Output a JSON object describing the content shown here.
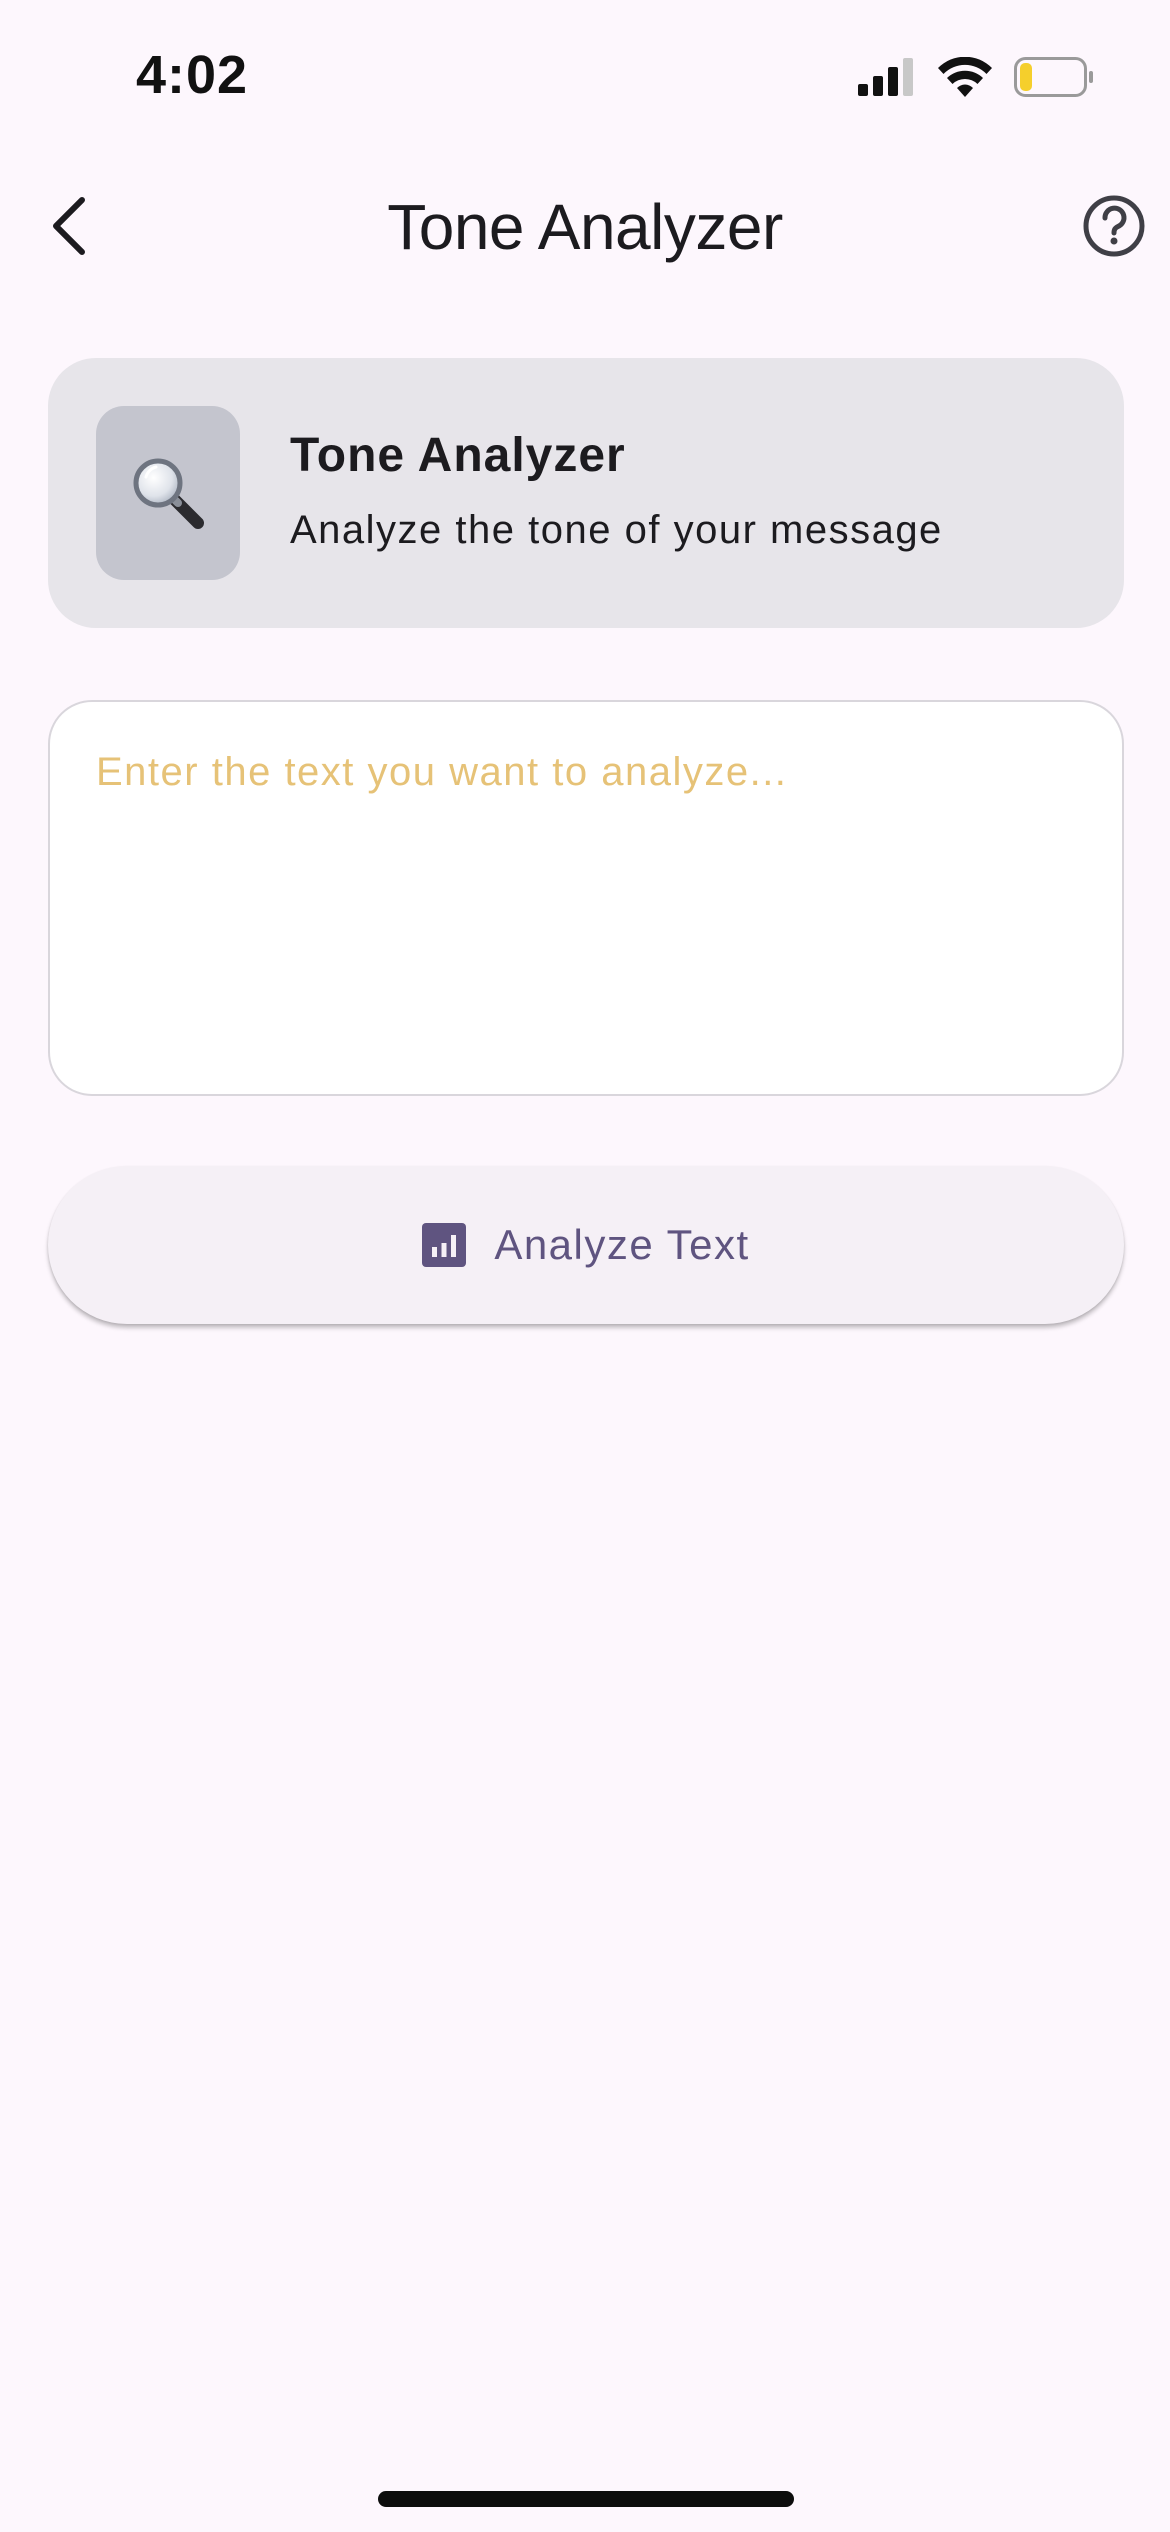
{
  "status_bar": {
    "time": "4:02",
    "icons": [
      "cellular-signal-icon",
      "wifi-icon",
      "battery-low-icon"
    ],
    "battery_color": "#f5cf2c"
  },
  "header": {
    "title": "Tone Analyzer",
    "back_icon": "chevron-left-icon",
    "help_icon": "help-circle-icon"
  },
  "info_card": {
    "icon": "magnifying-glass-icon",
    "title": "Tone Analyzer",
    "subtitle": "Analyze the tone of your message"
  },
  "text_input": {
    "value": "",
    "placeholder": "Enter the text you want to analyze..."
  },
  "analyze_button": {
    "icon": "bar-chart-icon",
    "label": "Analyze Text"
  },
  "colors": {
    "background": "#fdf7fd",
    "card": "#e7e5ea",
    "accent": "#5f5480",
    "placeholder": "#e6c277"
  }
}
